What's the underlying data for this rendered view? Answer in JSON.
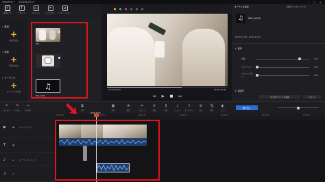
{
  "app": {
    "title": "VideoProc ▾",
    "project": "202206-29-1 ▾"
  },
  "toolbar": {
    "tabs": [
      {
        "label": "メディア",
        "icon": "media-icon",
        "active": true
      },
      {
        "label": "テキスト",
        "icon": "text-icon",
        "active": false
      },
      {
        "label": "タイトル",
        "icon": "title-icon",
        "active": false
      },
      {
        "label": "エフェクト",
        "icon": "effect-icon",
        "active": false
      },
      {
        "label": "トランジション",
        "icon": "transition-icon",
        "active": false
      }
    ]
  },
  "categories": [
    {
      "label": "動画",
      "add_text": "動画を追加"
    },
    {
      "label": "画像",
      "add_text": "画像を追加"
    },
    {
      "label": "オーディオ",
      "add_text": "オーディオを追加"
    }
  ],
  "media": {
    "items": [
      {
        "caption": "IMG",
        "icon": "video-thumbnail"
      },
      {
        "caption": "",
        "icon": "image-thumbnail"
      },
      {
        "caption": "IMG_0505",
        "icon": "music-note-icon"
      }
    ]
  },
  "preview": {
    "time_current": "00:00:15.80",
    "time_total": "00:00:23.80",
    "controls": [
      "⏮",
      "▶",
      "■",
      "⏭"
    ]
  },
  "properties": {
    "tabs": [
      "オーディオ設定",
      "",
      "",
      ""
    ],
    "clip_name": "IMG_0505",
    "info_label": "詳細 ライセンス 1/5",
    "range_label": "00:00:15.80 - 00:00:23.80",
    "section_audio": "音声",
    "sliders": [
      {
        "label": "音量",
        "value": "1.00",
        "level": 0.8
      },
      {
        "label": "フェードイン",
        "value": "0.00",
        "level": 0.02
      },
      {
        "label": "フェードアウト",
        "value": "0.00",
        "level": 0.02
      }
    ],
    "section_apply": "適用先",
    "apply_buttons": [
      "全てのクリップに適用",
      "リセット"
    ]
  },
  "timeline_tools": [
    {
      "label": "元に戻す",
      "icon": "undo-icon"
    },
    {
      "label": "やり直し",
      "icon": "redo-icon"
    },
    {
      "label": "切り取り",
      "icon": "cut-icon"
    },
    {
      "label": "分割",
      "icon": "split-icon"
    },
    {
      "label": "削除",
      "icon": "delete-icon"
    },
    {
      "label": "速度",
      "icon": "speed-icon"
    },
    {
      "label": "クロップ",
      "icon": "crop-icon"
    },
    {
      "label": "回転",
      "icon": "rotate-icon"
    },
    {
      "label": "分割",
      "icon": "split-icon"
    },
    {
      "label": "ミュート",
      "icon": "mute-icon"
    },
    {
      "label": "エクスポート",
      "icon": "export-icon"
    },
    {
      "label": "設定",
      "icon": "settings-icon"
    },
    {
      "label": "録音",
      "icon": "mic-icon"
    },
    {
      "label": "カラー",
      "icon": "color-icon"
    }
  ],
  "timeline": {
    "export_label": "書き出し",
    "playhead_time": "00:00:15.80",
    "tracks": [
      {
        "label": "メイントラック",
        "icon": "video-track-icon"
      },
      {
        "label": "",
        "icon": "subtitle-track-icon"
      },
      {
        "label": "オーディオトラック",
        "icon": "audio-track-icon"
      },
      {
        "label": "",
        "icon": "music-track-icon"
      }
    ],
    "ruler": [
      "00:00:00",
      "00:00:05",
      "00:00:10",
      "00:00:15",
      "00:00:20",
      "00:00:25",
      "00:00:30"
    ]
  },
  "colors": {
    "accent": "#f4b740",
    "highlight": "#e3141b",
    "audio_clip": "#1f3e6e",
    "export": "#2b6fd6"
  }
}
